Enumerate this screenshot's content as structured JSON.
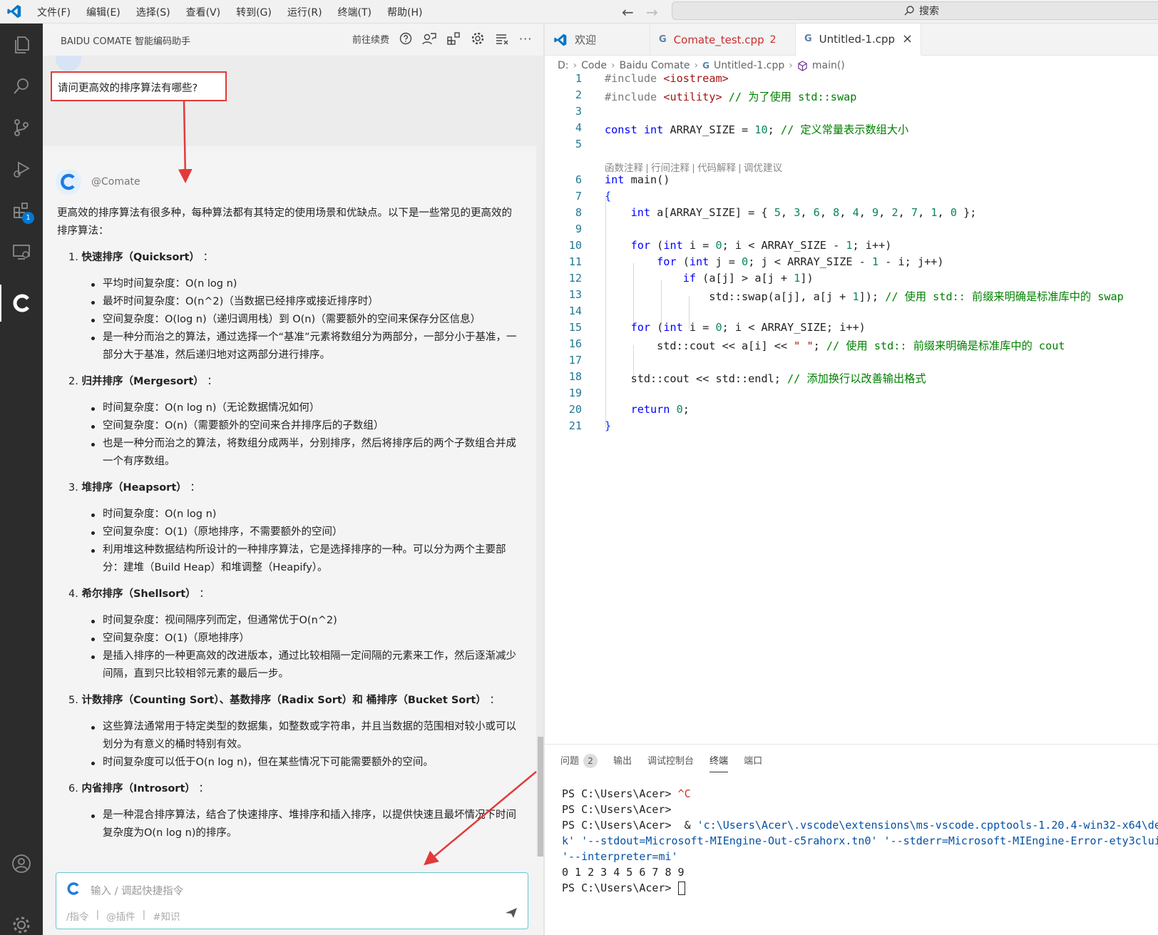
{
  "menu": [
    "文件(F)",
    "编辑(E)",
    "选择(S)",
    "查看(V)",
    "转到(G)",
    "运行(R)",
    "终端(T)",
    "帮助(H)"
  ],
  "search": {
    "label": "搜索"
  },
  "activity": {
    "extensions_badge": "1"
  },
  "chat": {
    "title": "BAIDU COMATE 智能编码助手",
    "header_action": "前往续费",
    "question": "请问更高效的排序算法有哪些?",
    "bot_name": "@Comate",
    "intro": "更高效的排序算法有很多种，每种算法都有其特定的使用场景和优缺点。以下是一些常见的更高效的排序算法：",
    "sections": [
      {
        "num": "1.",
        "title": "快速排序（Quicksort）",
        "suffix": "：",
        "bullets": [
          "平均时间复杂度：O(n log n)",
          "最坏时间复杂度：O(n^2)（当数据已经排序或接近排序时）",
          "空间复杂度：O(log n)（递归调用栈）到 O(n)（需要额外的空间来保存分区信息）",
          "是一种分而治之的算法，通过选择一个“基准”元素将数组分为两部分，一部分小于基准，一部分大于基准，然后递归地对这两部分进行排序。"
        ]
      },
      {
        "num": "2.",
        "title": "归并排序（Mergesort）",
        "suffix": "：",
        "bullets": [
          "时间复杂度：O(n log n)（无论数据情况如何）",
          "空间复杂度：O(n)（需要额外的空间来合并排序后的子数组）",
          "也是一种分而治之的算法，将数组分成两半，分别排序，然后将排序后的两个子数组合并成一个有序数组。"
        ]
      },
      {
        "num": "3.",
        "title": "堆排序（Heapsort）",
        "suffix": "：",
        "bullets": [
          "时间复杂度：O(n log n)",
          "空间复杂度：O(1)（原地排序，不需要额外的空间）",
          "利用堆这种数据结构所设计的一种排序算法，它是选择排序的一种。可以分为两个主要部分：建堆（Build Heap）和堆调整（Heapify）。"
        ]
      },
      {
        "num": "4.",
        "title": "希尔排序（Shellsort）",
        "suffix": "：",
        "bullets": [
          "时间复杂度：视间隔序列而定，但通常优于O(n^2)",
          "空间复杂度：O(1)（原地排序）",
          "是插入排序的一种更高效的改进版本，通过比较相隔一定间隔的元素来工作，然后逐渐减少间隔，直到只比较相邻元素的最后一步。"
        ]
      },
      {
        "num": "5.",
        "title": "计数排序（Counting Sort）、基数排序（Radix Sort）和 桶排序（Bucket Sort）",
        "suffix": "：",
        "bullets": [
          "这些算法通常用于特定类型的数据集，如整数或字符串，并且当数据的范围相对较小或可以划分为有意义的桶时特别有效。",
          "时间复杂度可以低于O(n log n)，但在某些情况下可能需要额外的空间。"
        ]
      },
      {
        "num": "6.",
        "title": "内省排序（Introsort）",
        "suffix": "：",
        "bullets": [
          "是一种混合排序算法，结合了快速排序、堆排序和插入排序，以提供快速且最坏情况下时间复杂度为O(n log n)的排序。"
        ]
      }
    ],
    "input_placeholder": "输入 / 调起快捷指令",
    "input_hints": [
      "/指令",
      "|",
      "@插件",
      "|",
      "#知识"
    ]
  },
  "tabs": [
    {
      "label": "欢迎",
      "color": "#555555"
    },
    {
      "label": "Comate_test.cpp",
      "badge": "2",
      "color": "#c72e2e"
    },
    {
      "label": "Untitled-1.cpp",
      "close": "×",
      "color": "#333333"
    }
  ],
  "breadcrumb": [
    "D:",
    "Code",
    "Baidu Comate",
    "Untitled-1.cpp",
    "main()"
  ],
  "codelens": "函数注释 | 行间注释 | 代码解释 | 调优建议",
  "code_lines": [
    {
      "n": "1",
      "html": "<span style='color:#7a7a7a'>#include</span> <span style='color:#a31515'>&lt;iostream&gt;</span>"
    },
    {
      "n": "2",
      "html": "<span style='color:#7a7a7a'>#include</span> <span style='color:#a31515'>&lt;utility&gt;</span> <span style='color:#008000'>// 为了使用 std::swap</span>"
    },
    {
      "n": "3",
      "html": ""
    },
    {
      "n": "4",
      "html": "<span style='color:#0000ff'>const</span> <span style='color:#0000ff'>int</span> ARRAY_SIZE = <span style='color:#098658'>10</span>; <span style='color:#008000'>// 定义常量表示数组大小</span>"
    },
    {
      "n": "5",
      "html": ""
    },
    {
      "n": "6",
      "html": "<span style='color:#0000ff'>int</span> main()"
    },
    {
      "n": "7",
      "html": "<span style='color:#0431fa'>{</span>"
    },
    {
      "n": "8",
      "html": "    <span style='color:#0000ff'>int</span> a[ARRAY_SIZE] = { <span style='color:#098658'>5</span>, <span style='color:#098658'>3</span>, <span style='color:#098658'>6</span>, <span style='color:#098658'>8</span>, <span style='color:#098658'>4</span>, <span style='color:#098658'>9</span>, <span style='color:#098658'>2</span>, <span style='color:#098658'>7</span>, <span style='color:#098658'>1</span>, <span style='color:#098658'>0</span> };"
    },
    {
      "n": "9",
      "html": ""
    },
    {
      "n": "10",
      "html": "    <span style='color:#0000ff'>for</span> (<span style='color:#0000ff'>int</span> i = <span style='color:#098658'>0</span>; i &lt; ARRAY_SIZE - <span style='color:#098658'>1</span>; i++)"
    },
    {
      "n": "11",
      "html": "        <span style='color:#0000ff'>for</span> (<span style='color:#0000ff'>int</span> j = <span style='color:#098658'>0</span>; j &lt; ARRAY_SIZE - <span style='color:#098658'>1</span> - i; j++)"
    },
    {
      "n": "12",
      "html": "            <span style='color:#0000ff'>if</span> (a[j] &gt; a[j + <span style='color:#098658'>1</span>])"
    },
    {
      "n": "13",
      "html": "                std::swap(a[j], a[j + <span style='color:#098658'>1</span>]); <span style='color:#008000'>// 使用 std:: 前缀来明确是标准库中的 swap</span>"
    },
    {
      "n": "14",
      "html": ""
    },
    {
      "n": "15",
      "html": "    <span style='color:#0000ff'>for</span> (<span style='color:#0000ff'>int</span> i = <span style='color:#098658'>0</span>; i &lt; ARRAY_SIZE; i++)"
    },
    {
      "n": "16",
      "html": "        std::cout &lt;&lt; a[i] &lt;&lt; <span style='color:#a31515'>\" \"</span>; <span style='color:#008000'>// 使用 std:: 前缀来明确是标准库中的 cout</span>"
    },
    {
      "n": "17",
      "html": ""
    },
    {
      "n": "18",
      "html": "    std::cout &lt;&lt; std::endl; <span style='color:#008000'>// 添加换行以改善输出格式</span>"
    },
    {
      "n": "19",
      "html": ""
    },
    {
      "n": "20",
      "html": "    <span style='color:#0000ff'>return</span> <span style='color:#098658'>0</span>;"
    },
    {
      "n": "21",
      "html": "<span style='color:#0431fa'>}</span>"
    }
  ],
  "panel": {
    "tabs": [
      "问题",
      "输出",
      "调试控制台",
      "终端",
      "端口"
    ],
    "problems_badge": "2",
    "active": "终端",
    "terminal_lines": [
      "PS C:\\Users\\Acer> <span style='color:#cd3131'>^C</span>",
      "PS C:\\Users\\Acer>",
      "PS C:\\Users\\Acer>  & <span style='color:#0451a5'>'c:\\Users\\Acer\\.vscode\\extensions\\ms-vscode.cpptools-1.20.4-win32-x64\\de</span>",
      "<span style='color:#0451a5'>k'</span> <span style='color:#0451a5'>'--stdout=Microsoft-MIEngine-Out-c5rahorx.tn0'</span> <span style='color:#0451a5'>'--stderr=Microsoft-MIEngine-Error-ety3clui</span>",
      "<span style='color:#0451a5'>'--interpreter=mi'</span>",
      "0 1 2 3 4 5 6 7 8 9",
      "PS C:\\Users\\Acer> <span class='cursor'></span>"
    ]
  },
  "colors": {
    "accent": "#0078d4",
    "highlight": "#e23a3a",
    "input_border": "#66c7d0"
  }
}
